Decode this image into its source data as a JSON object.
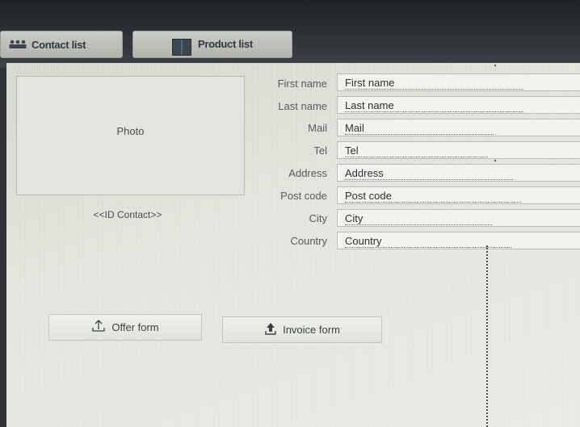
{
  "tabs": {
    "contact_list": "Contact list",
    "product_list": "Product list"
  },
  "photo": {
    "label": "Photo"
  },
  "id_contact": "<<ID Contact>>",
  "form": {
    "fields": [
      {
        "label": "First name",
        "value": "First name"
      },
      {
        "label": "Last name",
        "value": "Last name"
      },
      {
        "label": "Mail",
        "value": "Mail"
      },
      {
        "label": "Tel",
        "value": "Tel"
      },
      {
        "label": "Address",
        "value": "Address"
      },
      {
        "label": "Post code",
        "value": "Post code"
      },
      {
        "label": "City",
        "value": "City"
      },
      {
        "label": "Country",
        "value": "Country"
      }
    ]
  },
  "buttons": {
    "offer_form": "Offer form",
    "invoice_form": "Invoice form"
  },
  "icons": {
    "contact_list": "people-icon",
    "product_list": "columns-icon",
    "offer_form": "upload-icon",
    "invoice_form": "upload-icon"
  },
  "colors": {
    "topbar": "#2b2f34",
    "tab": "#c0c2ba",
    "content_bg": "#e4e6de"
  }
}
